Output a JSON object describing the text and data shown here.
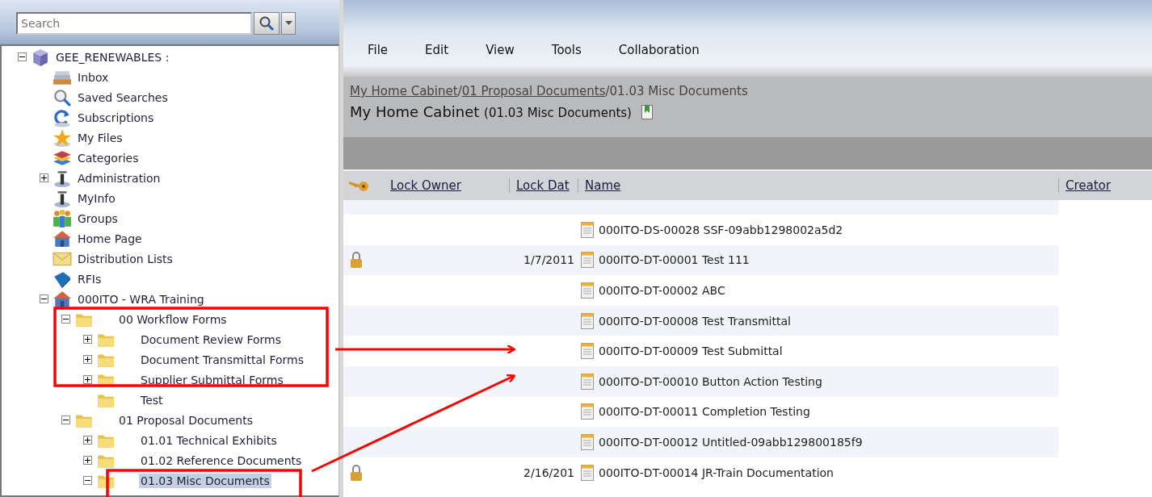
{
  "search": {
    "placeholder": "Search"
  },
  "tree": [
    {
      "label": "GEE_RENEWABLES :",
      "kind": "repository",
      "expanded": true,
      "selected": false,
      "children": [
        {
          "label": "Inbox",
          "kind": "inbox",
          "selected": false
        },
        {
          "label": "Saved Searches",
          "kind": "search",
          "selected": false
        },
        {
          "label": "Subscriptions",
          "kind": "subscriptions",
          "selected": false
        },
        {
          "label": "My Files",
          "kind": "star",
          "selected": false
        },
        {
          "label": "Categories",
          "kind": "categories",
          "selected": false
        },
        {
          "label": "Administration",
          "kind": "admin",
          "expanded": false,
          "selected": false
        },
        {
          "label": "MyInfo",
          "kind": "admin",
          "selected": false
        },
        {
          "label": "Groups",
          "kind": "groups",
          "selected": false
        },
        {
          "label": "Home Page",
          "kind": "home",
          "selected": false
        },
        {
          "label": "Distribution Lists",
          "kind": "mail",
          "selected": false
        },
        {
          "label": "RFIs",
          "kind": "rfi",
          "selected": false
        },
        {
          "label": "000ITO - WRA Training",
          "kind": "home",
          "expanded": true,
          "selected": false,
          "children": [
            {
              "label": "00 Workflow Forms",
              "kind": "folder",
              "expanded": true,
              "selected": false,
              "children": [
                {
                  "label": "Document Review Forms",
                  "kind": "folder",
                  "expanded": false,
                  "selected": false
                },
                {
                  "label": "Document Transmittal Forms",
                  "kind": "folder",
                  "expanded": false,
                  "selected": false
                },
                {
                  "label": "Supplier Submittal Forms",
                  "kind": "folder",
                  "expanded": false,
                  "selected": false
                },
                {
                  "label": "Test",
                  "kind": "folder",
                  "selected": false
                }
              ]
            },
            {
              "label": "01 Proposal Documents",
              "kind": "folder",
              "expanded": true,
              "selected": false,
              "children": [
                {
                  "label": "01.01 Technical Exhibits",
                  "kind": "folder",
                  "expanded": false,
                  "selected": false
                },
                {
                  "label": "01.02 Reference Documents",
                  "kind": "folder",
                  "expanded": false,
                  "selected": false
                },
                {
                  "label": "01.03 Misc Documents",
                  "kind": "folder",
                  "expanded": true,
                  "selected": true
                }
              ]
            }
          ]
        }
      ]
    }
  ],
  "menu": [
    "File",
    "Edit",
    "View",
    "Tools",
    "Collaboration"
  ],
  "breadcrumb": [
    "My Home Cabinet",
    "01 Proposal Documents",
    "01.03 Misc Documents"
  ],
  "breadcrumb_separator": "/",
  "title": {
    "main": "My Home Cabinet",
    "sub": "(01.03 Misc Documents)"
  },
  "table": {
    "columns": [
      "Lock Owner",
      "Lock Dat",
      "Name",
      "Creator"
    ],
    "rows": [
      {
        "locked": false,
        "lock_date": "",
        "name": "000ITO-DS-00028 SSF-09abb1298002a5d2"
      },
      {
        "locked": true,
        "lock_date": "1/7/2011",
        "name": "000ITO-DT-00001 Test 111"
      },
      {
        "locked": false,
        "lock_date": "",
        "name": "000ITO-DT-00002 ABC"
      },
      {
        "locked": false,
        "lock_date": "",
        "name": "000ITO-DT-00008 Test Transmittal"
      },
      {
        "locked": false,
        "lock_date": "",
        "name": "000ITO-DT-00009 Test Submittal"
      },
      {
        "locked": false,
        "lock_date": "",
        "name": "000ITO-DT-00010 Button Action Testing"
      },
      {
        "locked": false,
        "lock_date": "",
        "name": "000ITO-DT-00011 Completion Testing"
      },
      {
        "locked": false,
        "lock_date": "",
        "name": "000ITO-DT-00012 Untitled-09abb129800185f9"
      },
      {
        "locked": true,
        "lock_date": "2/16/201",
        "name": "000ITO-DT-00014 JR-Train Documentation"
      }
    ]
  }
}
